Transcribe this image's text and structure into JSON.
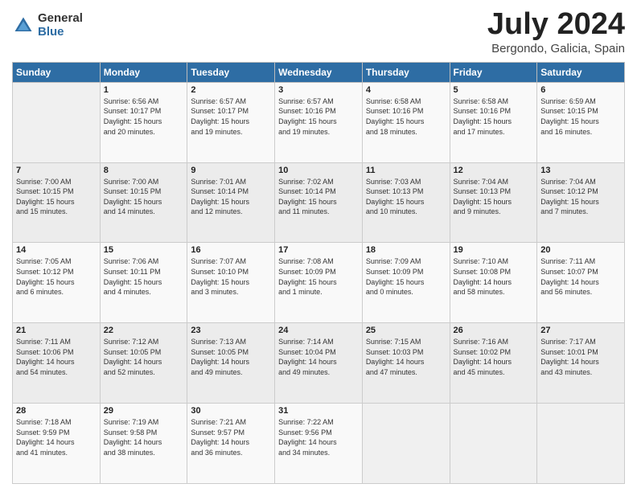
{
  "header": {
    "logo_general": "General",
    "logo_blue": "Blue",
    "month_title": "July 2024",
    "location": "Bergondo, Galicia, Spain"
  },
  "days_of_week": [
    "Sunday",
    "Monday",
    "Tuesday",
    "Wednesday",
    "Thursday",
    "Friday",
    "Saturday"
  ],
  "weeks": [
    [
      {
        "day": "",
        "info": ""
      },
      {
        "day": "1",
        "info": "Sunrise: 6:56 AM\nSunset: 10:17 PM\nDaylight: 15 hours\nand 20 minutes."
      },
      {
        "day": "2",
        "info": "Sunrise: 6:57 AM\nSunset: 10:17 PM\nDaylight: 15 hours\nand 19 minutes."
      },
      {
        "day": "3",
        "info": "Sunrise: 6:57 AM\nSunset: 10:16 PM\nDaylight: 15 hours\nand 19 minutes."
      },
      {
        "day": "4",
        "info": "Sunrise: 6:58 AM\nSunset: 10:16 PM\nDaylight: 15 hours\nand 18 minutes."
      },
      {
        "day": "5",
        "info": "Sunrise: 6:58 AM\nSunset: 10:16 PM\nDaylight: 15 hours\nand 17 minutes."
      },
      {
        "day": "6",
        "info": "Sunrise: 6:59 AM\nSunset: 10:15 PM\nDaylight: 15 hours\nand 16 minutes."
      }
    ],
    [
      {
        "day": "7",
        "info": "Sunrise: 7:00 AM\nSunset: 10:15 PM\nDaylight: 15 hours\nand 15 minutes."
      },
      {
        "day": "8",
        "info": "Sunrise: 7:00 AM\nSunset: 10:15 PM\nDaylight: 15 hours\nand 14 minutes."
      },
      {
        "day": "9",
        "info": "Sunrise: 7:01 AM\nSunset: 10:14 PM\nDaylight: 15 hours\nand 12 minutes."
      },
      {
        "day": "10",
        "info": "Sunrise: 7:02 AM\nSunset: 10:14 PM\nDaylight: 15 hours\nand 11 minutes."
      },
      {
        "day": "11",
        "info": "Sunrise: 7:03 AM\nSunset: 10:13 PM\nDaylight: 15 hours\nand 10 minutes."
      },
      {
        "day": "12",
        "info": "Sunrise: 7:04 AM\nSunset: 10:13 PM\nDaylight: 15 hours\nand 9 minutes."
      },
      {
        "day": "13",
        "info": "Sunrise: 7:04 AM\nSunset: 10:12 PM\nDaylight: 15 hours\nand 7 minutes."
      }
    ],
    [
      {
        "day": "14",
        "info": "Sunrise: 7:05 AM\nSunset: 10:12 PM\nDaylight: 15 hours\nand 6 minutes."
      },
      {
        "day": "15",
        "info": "Sunrise: 7:06 AM\nSunset: 10:11 PM\nDaylight: 15 hours\nand 4 minutes."
      },
      {
        "day": "16",
        "info": "Sunrise: 7:07 AM\nSunset: 10:10 PM\nDaylight: 15 hours\nand 3 minutes."
      },
      {
        "day": "17",
        "info": "Sunrise: 7:08 AM\nSunset: 10:09 PM\nDaylight: 15 hours\nand 1 minute."
      },
      {
        "day": "18",
        "info": "Sunrise: 7:09 AM\nSunset: 10:09 PM\nDaylight: 15 hours\nand 0 minutes."
      },
      {
        "day": "19",
        "info": "Sunrise: 7:10 AM\nSunset: 10:08 PM\nDaylight: 14 hours\nand 58 minutes."
      },
      {
        "day": "20",
        "info": "Sunrise: 7:11 AM\nSunset: 10:07 PM\nDaylight: 14 hours\nand 56 minutes."
      }
    ],
    [
      {
        "day": "21",
        "info": "Sunrise: 7:11 AM\nSunset: 10:06 PM\nDaylight: 14 hours\nand 54 minutes."
      },
      {
        "day": "22",
        "info": "Sunrise: 7:12 AM\nSunset: 10:05 PM\nDaylight: 14 hours\nand 52 minutes."
      },
      {
        "day": "23",
        "info": "Sunrise: 7:13 AM\nSunset: 10:05 PM\nDaylight: 14 hours\nand 49 minutes."
      },
      {
        "day": "24",
        "info": "Sunrise: 7:14 AM\nSunset: 10:04 PM\nDaylight: 14 hours\nand 49 minutes."
      },
      {
        "day": "25",
        "info": "Sunrise: 7:15 AM\nSunset: 10:03 PM\nDaylight: 14 hours\nand 47 minutes."
      },
      {
        "day": "26",
        "info": "Sunrise: 7:16 AM\nSunset: 10:02 PM\nDaylight: 14 hours\nand 45 minutes."
      },
      {
        "day": "27",
        "info": "Sunrise: 7:17 AM\nSunset: 10:01 PM\nDaylight: 14 hours\nand 43 minutes."
      }
    ],
    [
      {
        "day": "28",
        "info": "Sunrise: 7:18 AM\nSunset: 9:59 PM\nDaylight: 14 hours\nand 41 minutes."
      },
      {
        "day": "29",
        "info": "Sunrise: 7:19 AM\nSunset: 9:58 PM\nDaylight: 14 hours\nand 38 minutes."
      },
      {
        "day": "30",
        "info": "Sunrise: 7:21 AM\nSunset: 9:57 PM\nDaylight: 14 hours\nand 36 minutes."
      },
      {
        "day": "31",
        "info": "Sunrise: 7:22 AM\nSunset: 9:56 PM\nDaylight: 14 hours\nand 34 minutes."
      },
      {
        "day": "",
        "info": ""
      },
      {
        "day": "",
        "info": ""
      },
      {
        "day": "",
        "info": ""
      }
    ]
  ]
}
